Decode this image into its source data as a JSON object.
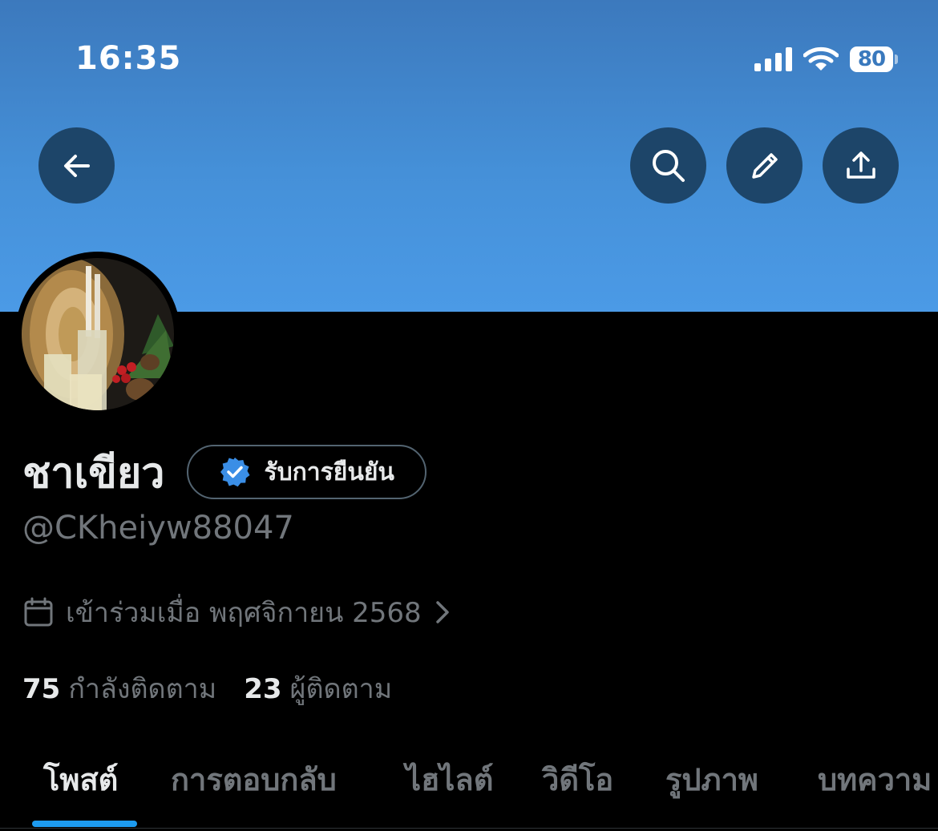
{
  "status_bar": {
    "time": "16:35",
    "battery": "80"
  },
  "profile": {
    "display_name": "ชาเขียว",
    "verify_label": "รับการยืนยัน",
    "handle": "@CKheiyw88047",
    "joined": "เข้าร่วมเมื่อ พฤศจิกายน 2568",
    "following_count": "75",
    "following_label": "กำลังติดตาม",
    "followers_count": "23",
    "followers_label": "ผู้ติดตาม"
  },
  "tabs": [
    "โพสต์",
    "การตอบกลับ",
    "ไฮไลต์",
    "วิดีโอ",
    "รูปภาพ",
    "บทความ"
  ],
  "colors": {
    "accent": "#1d9bf0",
    "banner": "#4590d8",
    "button_bg": "#1d4569",
    "muted_text": "#71767b"
  },
  "icons": [
    "back-arrow-icon",
    "search-icon",
    "pencil-icon",
    "share-icon",
    "verified-badge-icon",
    "calendar-icon",
    "chevron-right-icon"
  ]
}
